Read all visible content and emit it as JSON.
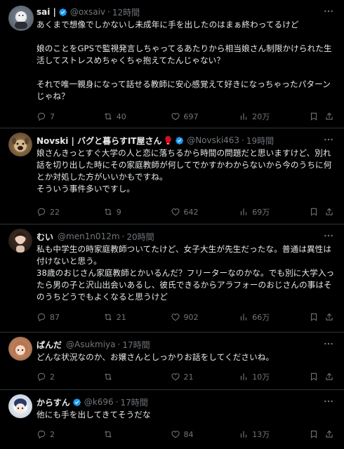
{
  "colors": {
    "background": "#000000",
    "text": "#e7e9ea",
    "muted": "#71767b",
    "verified": "#1d9bf0",
    "divider": "#2f3336"
  },
  "tweets": [
    {
      "name": "sai |",
      "handle": "@oxsaiv",
      "dot": "·",
      "time": "12時間",
      "body": "あくまで想像でしかないし未成年に手を出したのはまぁ終わってるけど\n\n娘のことをGPSで監視発言しちゃってるあたりから相当娘さん制限かけられた生活してストレスめちゃくちゃ抱えてたんじゃない？\n\nそれで唯一親身になって話せる教師に安心感覚えて好きになっちゃったパターンじゃね？",
      "replies": "7",
      "retweets": "40",
      "likes": "697",
      "views": "20万"
    },
    {
      "name": "Novski | バグと暮らすIT屋さん",
      "handle": "@Novski463",
      "dot": "·",
      "time": "19時間",
      "body": "娘さんきっとすぐ大学の人と恋に落ちるから時間の問題だと思いますけど、別れ話を切り出した時にその家庭教師が何してでかすかわからないから今のうちに何とか対処した方がいいかもですね。\nそういう事件多いですし。",
      "replies": "22",
      "retweets": "9",
      "likes": "642",
      "views": "69万"
    },
    {
      "name": "むい",
      "handle": "@men1n012m",
      "dot": "·",
      "time": "20時間",
      "body": "私も中学生の時家庭教師ついてたけど、女子大生が先生だったな。普通は異性は付けないと思う。\n38歳のおじさん家庭教師とかいるんだ？フリーターなのかな。でも別に大学入ったら男の子と沢山出会いあるし、彼氏できるからアラフォーのおじさんの事はそのうちどうでもよくなると思うけど",
      "replies": "87",
      "retweets": "21",
      "likes": "902",
      "views": "66万"
    },
    {
      "name": "ぱんだ",
      "handle": "@Asukmiya",
      "dot": "·",
      "time": "17時間",
      "body": "どんな状況なのか、お嬢さんとしっかりお話をしてくださいね。",
      "replies": "2",
      "retweets": "",
      "likes": "21",
      "views": "10万"
    },
    {
      "name": "からすん",
      "handle": "@k696",
      "dot": "·",
      "time": "17時間",
      "body": "他にも手を出してきてそうだな",
      "replies": "2",
      "retweets": "",
      "likes": "84",
      "views": "13万"
    }
  ]
}
